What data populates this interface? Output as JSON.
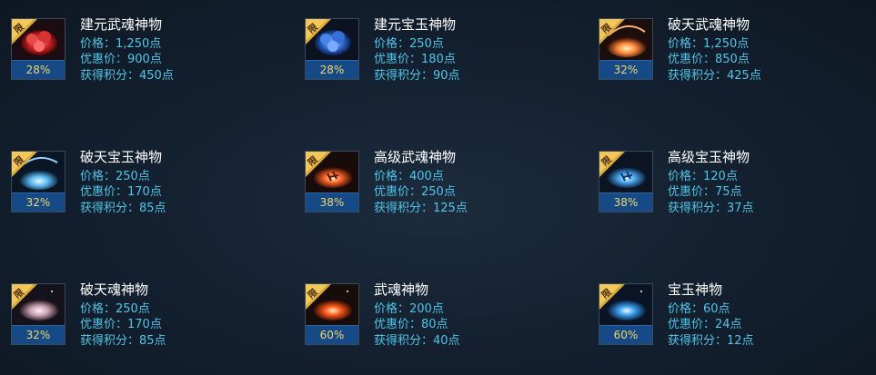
{
  "badge_label": "限",
  "colors": {
    "price_text": "#4fc6ea",
    "name_text": "#ffffff",
    "percent_text": "#f2d66a",
    "percent_bg": "#164a86",
    "badge_gold": "#d9a93a"
  },
  "labels": {
    "price": "价格：",
    "discount": "优惠价：",
    "points": "获得积分："
  },
  "items": [
    {
      "name": "建元武魂神物",
      "price": "1,250点",
      "discount_price": "900点",
      "points": "450点",
      "percent": "28%",
      "icon": "red-crystal-flower-icon"
    },
    {
      "name": "建元宝玉神物",
      "price": "250点",
      "discount_price": "180点",
      "points": "90点",
      "percent": "28%",
      "icon": "blue-crystal-flower-icon"
    },
    {
      "name": "破天武魂神物",
      "price": "1,250点",
      "discount_price": "850点",
      "points": "425点",
      "percent": "32%",
      "icon": "fire-swirl-orb-icon"
    },
    {
      "name": "破天宝玉神物",
      "price": "250点",
      "discount_price": "170点",
      "points": "85点",
      "percent": "32%",
      "icon": "blue-swirl-orb-icon"
    },
    {
      "name": "高级武魂神物",
      "price": "400点",
      "discount_price": "250点",
      "points": "125点",
      "percent": "38%",
      "icon": "red-rune-orb-icon"
    },
    {
      "name": "高级宝玉神物",
      "price": "120点",
      "discount_price": "75点",
      "points": "37点",
      "percent": "38%",
      "icon": "blue-rune-orb-icon"
    },
    {
      "name": "破天魂神物",
      "price": "250点",
      "discount_price": "170点",
      "points": "85点",
      "percent": "32%",
      "icon": "grey-pink-orb-icon"
    },
    {
      "name": "武魂神物",
      "price": "200点",
      "discount_price": "80点",
      "points": "40点",
      "percent": "60%",
      "icon": "red-glow-orb-icon"
    },
    {
      "name": "宝玉神物",
      "price": "60点",
      "discount_price": "24点",
      "points": "12点",
      "percent": "60%",
      "icon": "blue-glow-orb-icon"
    }
  ]
}
